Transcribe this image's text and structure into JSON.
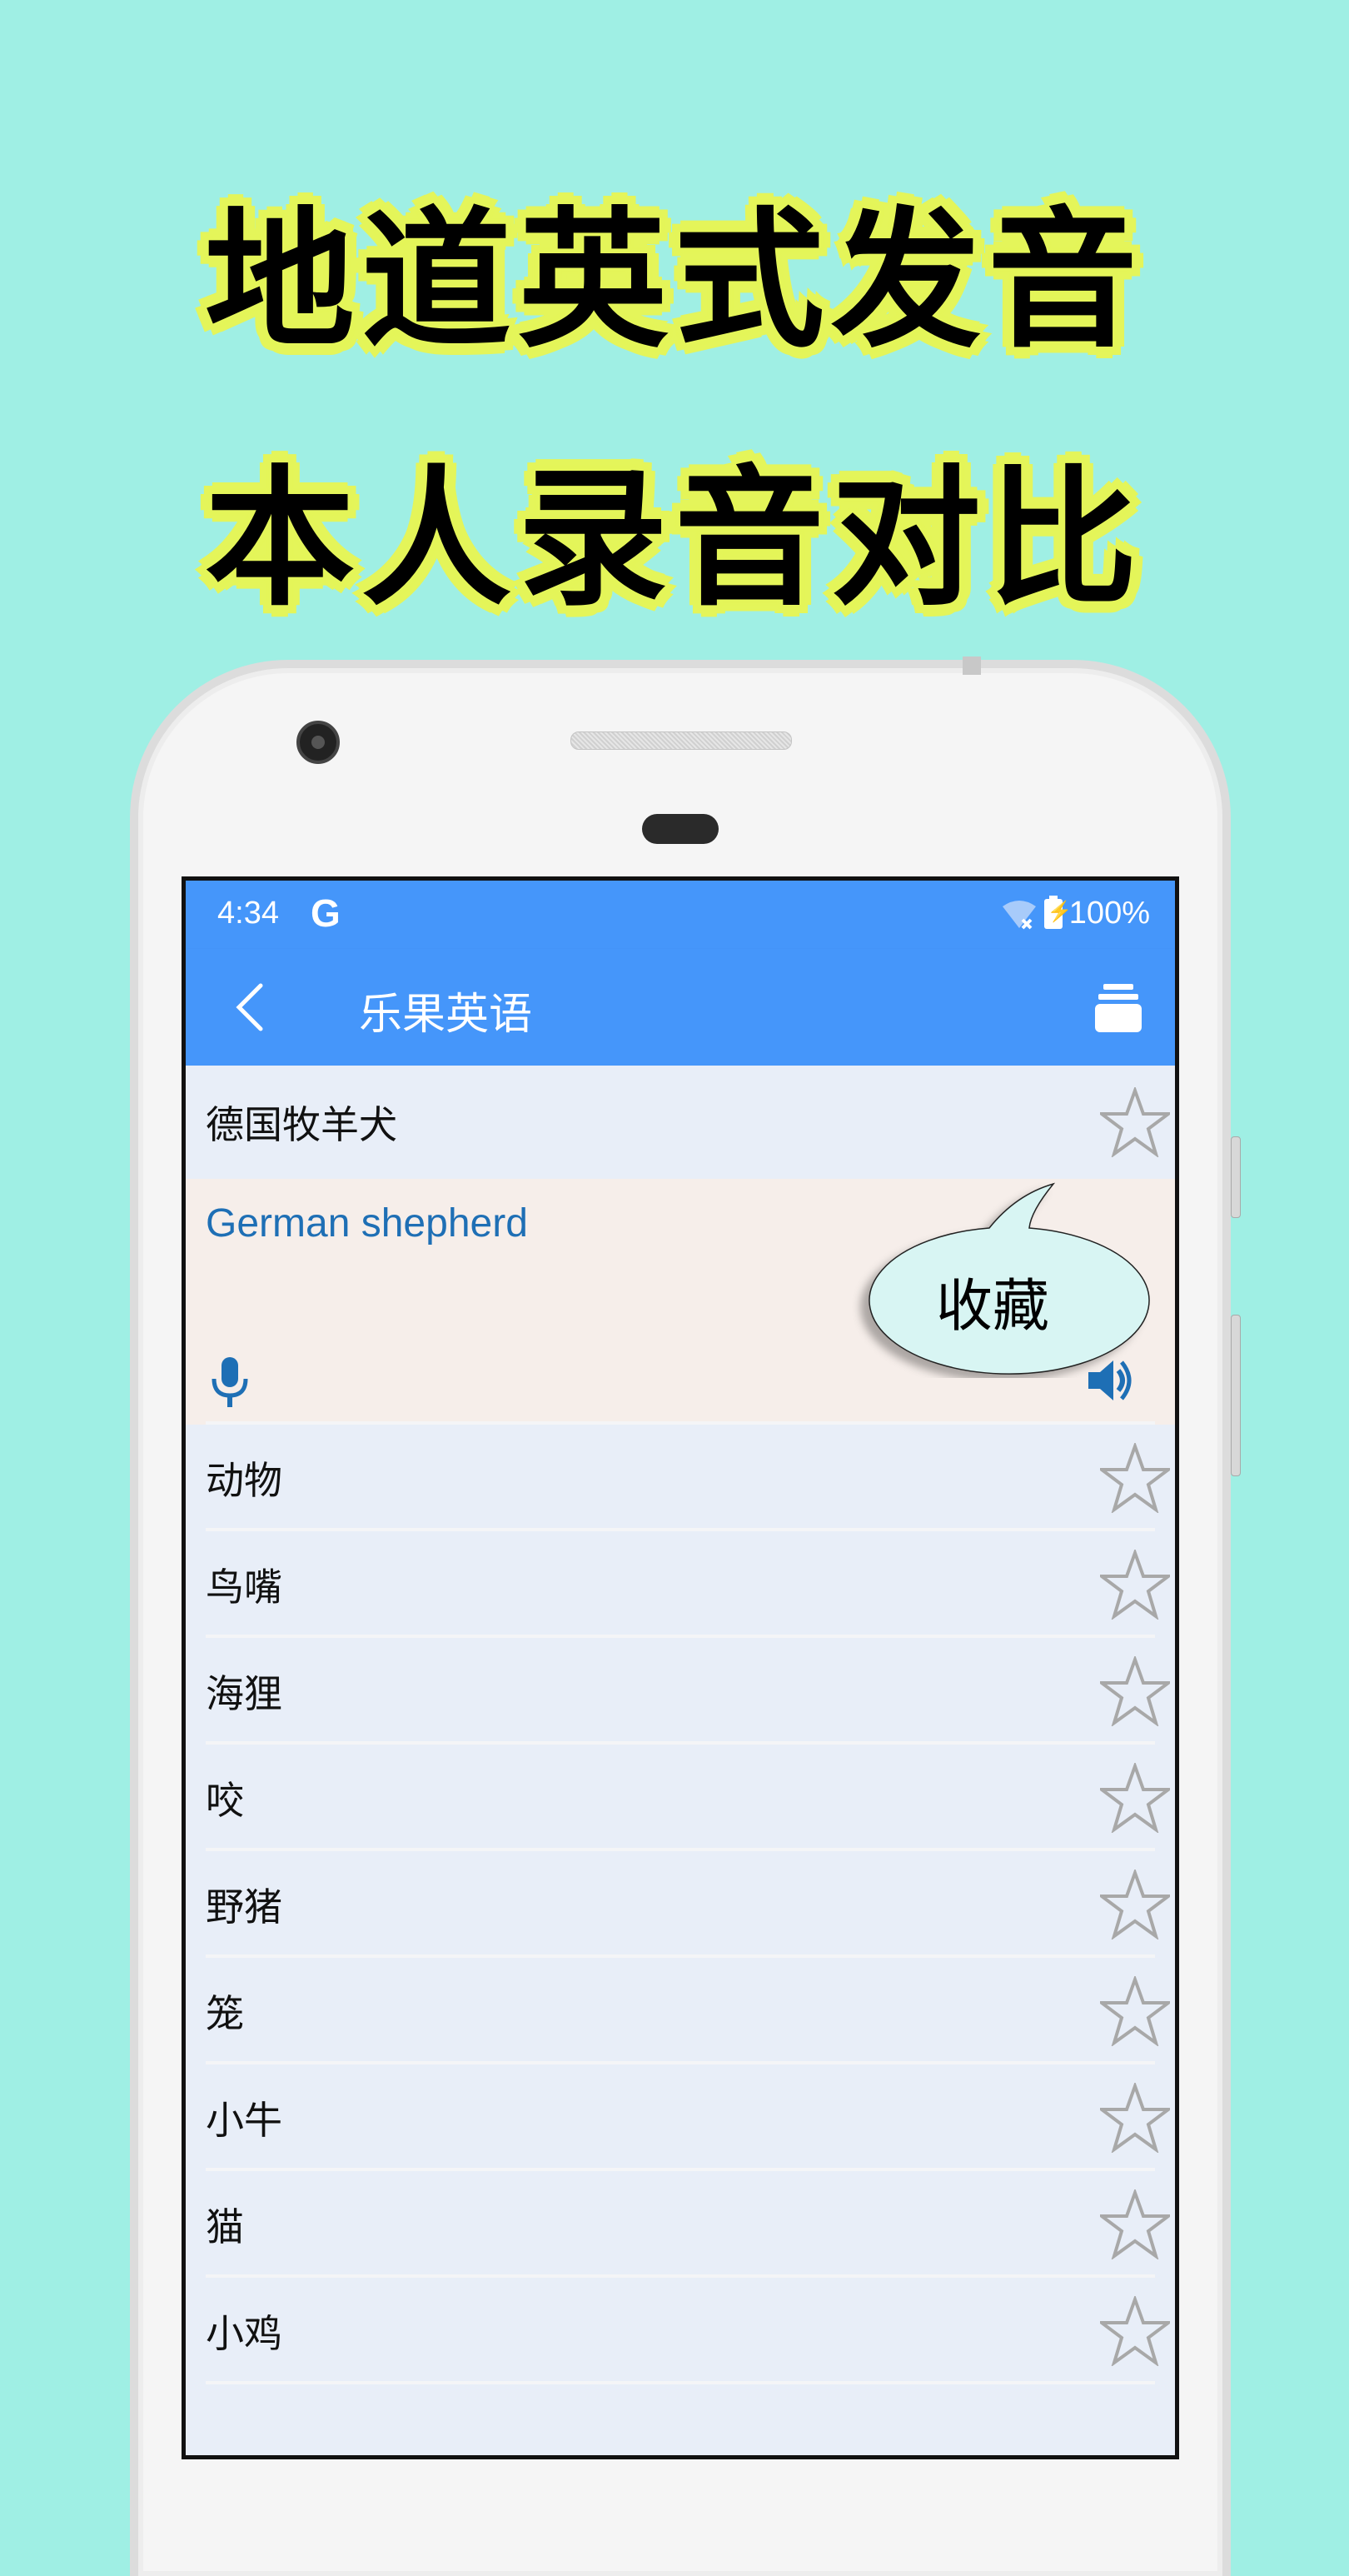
{
  "promo": {
    "line1": "地道英式发音",
    "line2": "本人录音对比"
  },
  "status_bar": {
    "time": "4:34",
    "g_icon": "G",
    "battery_percent": "100%",
    "icons": [
      "wifi-off-icon",
      "battery-charging-icon"
    ]
  },
  "app_bar": {
    "title": "乐果英语",
    "back_icon": "chevron-left-icon",
    "menu_icon": "stack-icon"
  },
  "selected_item": {
    "chinese": "德国牧羊犬",
    "english": "German shepherd",
    "starred": false
  },
  "callout": {
    "text": "收藏"
  },
  "colors": {
    "background": "#9FEFE4",
    "app_bar": "#4596FA",
    "english_text": "#1E6FB5",
    "expanded_bg": "#F6EEEA",
    "list_bg": "#E8EEF8",
    "promo_outline": "#E4F55A"
  },
  "list": [
    {
      "label": "动物",
      "starred": false
    },
    {
      "label": "鸟嘴",
      "starred": false
    },
    {
      "label": "海狸",
      "starred": false
    },
    {
      "label": "咬",
      "starred": false
    },
    {
      "label": "野猪",
      "starred": false
    },
    {
      "label": "笼",
      "starred": false
    },
    {
      "label": "小牛",
      "starred": false
    },
    {
      "label": "猫",
      "starred": false
    },
    {
      "label": "小鸡",
      "starred": false
    }
  ]
}
